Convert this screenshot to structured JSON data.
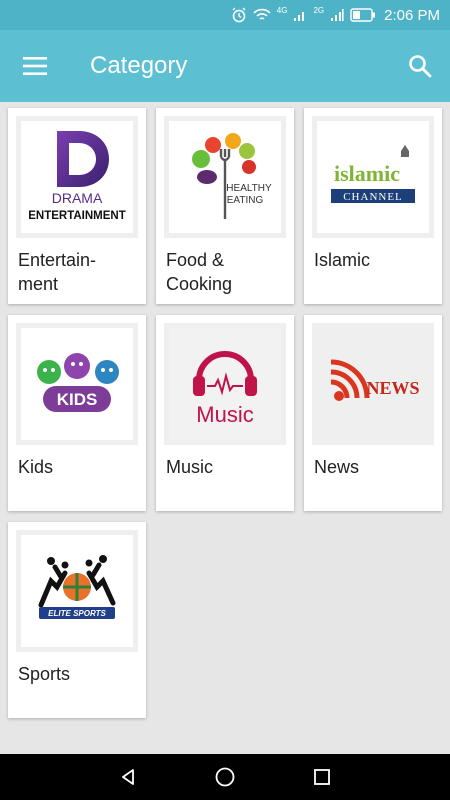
{
  "status_bar": {
    "time": "2:06 PM",
    "network_labels": [
      "4G",
      "2G"
    ],
    "icons": [
      "alarm-icon",
      "wifi-icon",
      "signal-icon",
      "battery-icon"
    ]
  },
  "app_bar": {
    "title": "Category",
    "menu_icon": "hamburger-menu-icon",
    "search_icon": "search-icon",
    "background": "#5cc0d2"
  },
  "categories": [
    {
      "label": "Entertain-\nment",
      "logo": {
        "big": "D",
        "line1": "DRAMA",
        "line2": "ENTERTAINMENT"
      }
    },
    {
      "label": "Food &\nCooking",
      "logo": {
        "line1": "HEALTHY",
        "line2": "EATING"
      }
    },
    {
      "label": "Islamic",
      "logo": {
        "line1": "islamic",
        "line2": "CHANNEL"
      }
    },
    {
      "label": "Kids",
      "logo": {
        "line1": "KIDS"
      }
    },
    {
      "label": "Music",
      "logo": {
        "line1": "Music"
      }
    },
    {
      "label": "News",
      "logo": {
        "line1": "NEWS"
      }
    },
    {
      "label": "Sports",
      "logo": {
        "line1": "ELITE SPORTS"
      }
    }
  ],
  "nav_bar": {
    "icons": [
      "back-icon",
      "home-icon",
      "recents-icon"
    ]
  }
}
